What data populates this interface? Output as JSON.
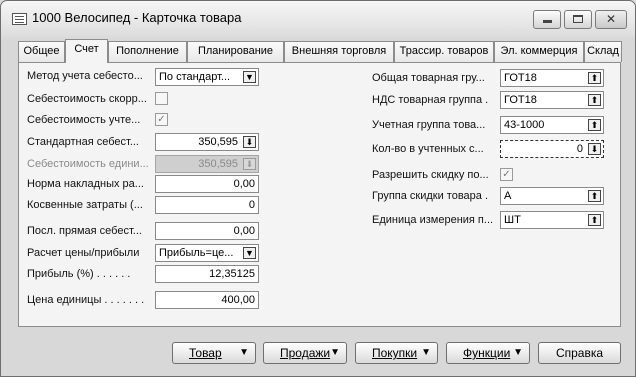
{
  "window": {
    "title": "1000 Велосипед - Карточка товара",
    "min_symbol": "",
    "max_symbol": "",
    "close_symbol": "✕"
  },
  "tabs": [
    {
      "label": "Общее"
    },
    {
      "label": "Счет"
    },
    {
      "label": "Пополнение"
    },
    {
      "label": "Планирование"
    },
    {
      "label": "Внешняя торговля"
    },
    {
      "label": "Трассир. товаров"
    },
    {
      "label": "Эл. коммерция"
    },
    {
      "label": "Склад"
    }
  ],
  "active_tab": "Счет",
  "left": {
    "costing_method": {
      "label": "Метод учета себесто...",
      "value": "По стандарт..."
    },
    "cost_adjusted": {
      "label": "Себестоимость скорр...",
      "checked": false
    },
    "cost_posted": {
      "label": "Себестоимость учте...",
      "checked": true
    },
    "standard_cost": {
      "label": "Стандартная себест...",
      "value": "350,595"
    },
    "unit_cost": {
      "label": "Себестоимость едини...",
      "value": "350,595"
    },
    "overhead_rate": {
      "label": "Норма накладных ра...",
      "value": "0,00"
    },
    "indirect_cost": {
      "label": "Косвенные затраты (...",
      "value": "0"
    },
    "last_direct_cost": {
      "label": "Посл. прямая себест...",
      "value": "0,00"
    },
    "price_profit_calc": {
      "label": "Расчет цены/прибыли",
      "value": "Прибыль=це..."
    },
    "profit_pct": {
      "label": "Прибыль (%)",
      "value": "12,35125"
    },
    "unit_price": {
      "label": "Цена единицы",
      "value": "400,00"
    }
  },
  "right": {
    "gen_prod_group": {
      "label": "Общая товарная гру...",
      "value": "ГОТ18"
    },
    "vat_prod_group": {
      "label": "НДС товарная группа",
      "value": "ГОТ18"
    },
    "inventory_group": {
      "label": "Учетная группа това...",
      "value": "43-1000"
    },
    "qty_on_hand": {
      "label": "Кол-во в учтенных с...",
      "value": "0"
    },
    "allow_discount": {
      "label": "Разрешить скидку по...",
      "checked": true
    },
    "discount_group": {
      "label": "Группа скидки товара",
      "value": "А"
    },
    "base_uom": {
      "label": "Единица измерения п...",
      "value": "ШТ"
    }
  },
  "buttons": {
    "item": "Товар",
    "sales": "Продажи",
    "purchases": "Покупки",
    "functions": "Функции",
    "help": "Справка"
  },
  "icons": {
    "dropdown": "▼",
    "lookup": "⬆",
    "drilldown": "⬇",
    "check": "✓"
  }
}
